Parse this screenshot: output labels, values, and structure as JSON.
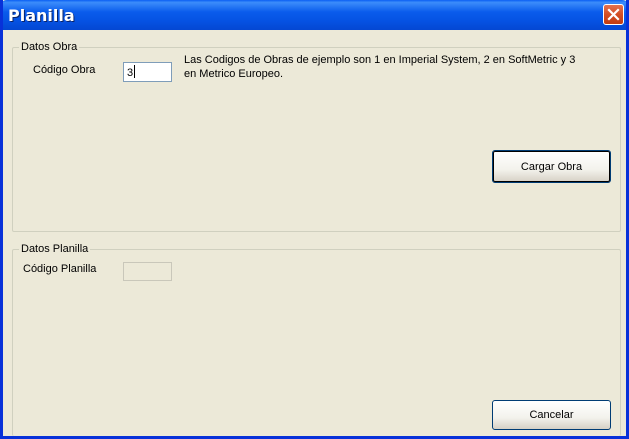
{
  "window": {
    "title": "Planilla"
  },
  "obra_group": {
    "legend": "Datos Obra",
    "codigo_label": "Código Obra",
    "codigo_value": "3",
    "description": "Las Codigos de Obras de ejemplo son 1 en Imperial System, 2 en SoftMetric y 3 en Metrico Europeo.",
    "cargar_button": "Cargar Obra"
  },
  "planilla_group": {
    "legend": "Datos Planilla",
    "codigo_label": "Código Planilla",
    "codigo_value": "",
    "cancelar_button": "Cancelar"
  },
  "colors": {
    "titlebar": "#0A5CEC",
    "window_bg": "#ECE9D8",
    "close_button": "#D24E24"
  },
  "icons": {
    "close": "close-icon"
  }
}
